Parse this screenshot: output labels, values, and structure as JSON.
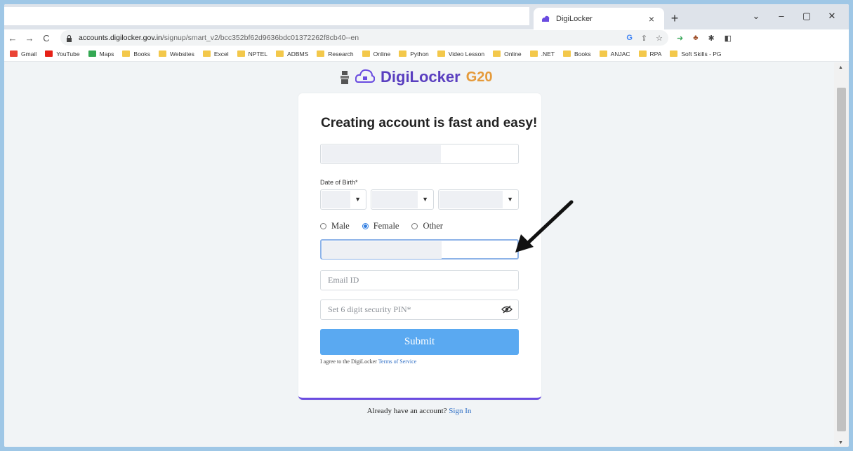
{
  "browser": {
    "tab_title": "DigiLocker",
    "tab_close": "×",
    "new_tab": "+",
    "window_controls": [
      "⌄",
      "–",
      "▢",
      "✕"
    ],
    "url_host": "accounts.digilocker.gov.in",
    "url_path": "/signup/smart_v2/bcc352bf62d9636bdc01372262f8cb40--en",
    "nav": [
      "←",
      "→",
      "C"
    ]
  },
  "bookmarks": [
    {
      "label": "Gmail",
      "icon": "gmail-icon"
    },
    {
      "label": "YouTube",
      "icon": "youtube-icon"
    },
    {
      "label": "Maps",
      "icon": "maps-icon"
    },
    {
      "label": "Books",
      "icon": "folder-icon"
    },
    {
      "label": "Websites",
      "icon": "folder-icon"
    },
    {
      "label": "Excel",
      "icon": "folder-icon"
    },
    {
      "label": "NPTEL",
      "icon": "folder-icon"
    },
    {
      "label": "ADBMS",
      "icon": "folder-icon"
    },
    {
      "label": "Research",
      "icon": "folder-icon"
    },
    {
      "label": "Online",
      "icon": "folder-icon"
    },
    {
      "label": "Python",
      "icon": "folder-icon"
    },
    {
      "label": "Video Lesson",
      "icon": "folder-icon"
    },
    {
      "label": "Online",
      "icon": "folder-icon"
    },
    {
      "label": ".NET",
      "icon": "folder-icon"
    },
    {
      "label": "Books",
      "icon": "folder-icon"
    },
    {
      "label": "ANJAC",
      "icon": "folder-icon"
    },
    {
      "label": "RPA",
      "icon": "folder-icon"
    },
    {
      "label": "Soft Skills - PG",
      "icon": "folder-icon"
    }
  ],
  "page": {
    "brand": "DigiLocker",
    "heading": "Creating account is fast and easy!",
    "dob_label": "Date of Birth*",
    "gender_options": [
      {
        "label": "Male",
        "checked": false
      },
      {
        "label": "Female",
        "checked": true
      },
      {
        "label": "Other",
        "checked": false
      }
    ],
    "email_placeholder": "Email ID",
    "pin_placeholder": "Set 6 digit security PIN*",
    "submit_label": "Submit",
    "terms_prefix": "I agree to the DigiLocker",
    "terms_link": "Terms of Service",
    "signin_prefix": "Already have an account?",
    "signin_link": "Sign In"
  },
  "colors": {
    "accent": "#5aa9f1",
    "brand": "#6a4ce0",
    "radio_checked": "#2f7de1",
    "link": "#2b6cc4"
  }
}
